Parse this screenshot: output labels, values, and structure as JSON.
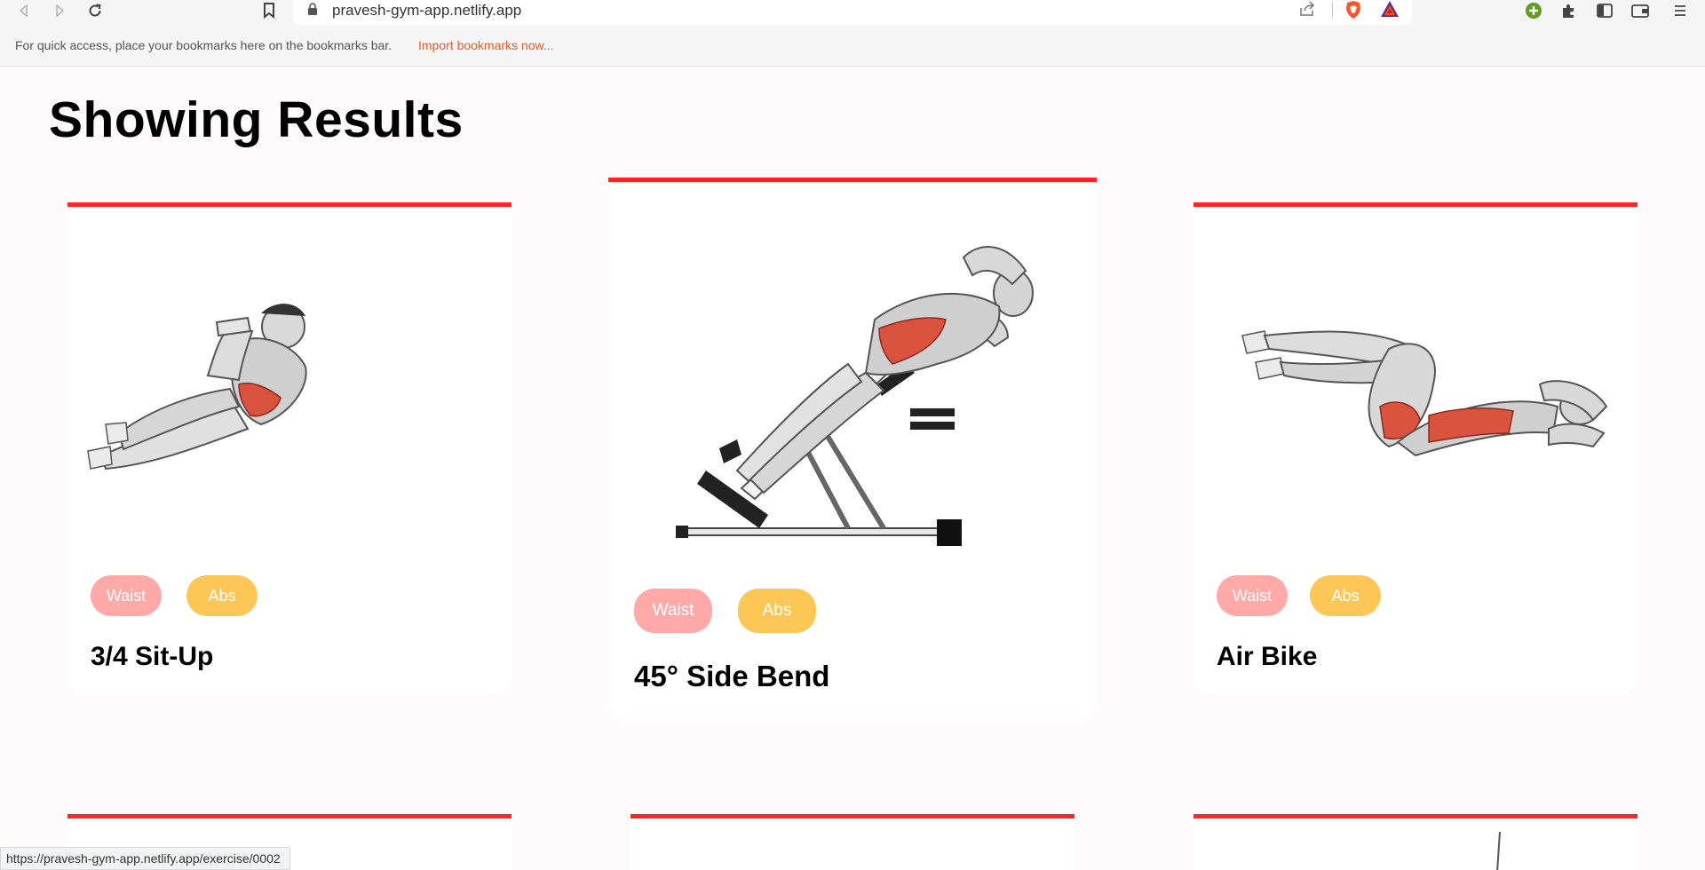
{
  "browser": {
    "url": "pravesh-gym-app.netlify.app",
    "bookmarks_message": "For quick access, place your bookmarks here on the bookmarks bar.",
    "bookmarks_link": "Import bookmarks now...",
    "status_url": "https://pravesh-gym-app.netlify.app/exercise/0002"
  },
  "page": {
    "title": "Showing Results"
  },
  "exercises": [
    {
      "name": "3/4 Sit-Up",
      "tags": [
        "Waist",
        "Abs"
      ]
    },
    {
      "name": "45° Side Bend",
      "tags": [
        "Waist",
        "Abs"
      ]
    },
    {
      "name": "Air Bike",
      "tags": [
        "Waist",
        "Abs"
      ]
    }
  ],
  "colors": {
    "accent": "#ff2625",
    "waist_tag": "#ffa9a9",
    "abs_tag": "#fcc757",
    "page_bg": "#fffafb"
  },
  "icons": [
    "back-icon",
    "forward-icon",
    "reload-icon",
    "bookmark-icon",
    "lock-icon",
    "share-icon",
    "brave-shield-icon",
    "bat-rewards-icon",
    "vpn-icon",
    "extensions-icon",
    "sidebar-icon",
    "wallet-icon",
    "menu-icon"
  ]
}
